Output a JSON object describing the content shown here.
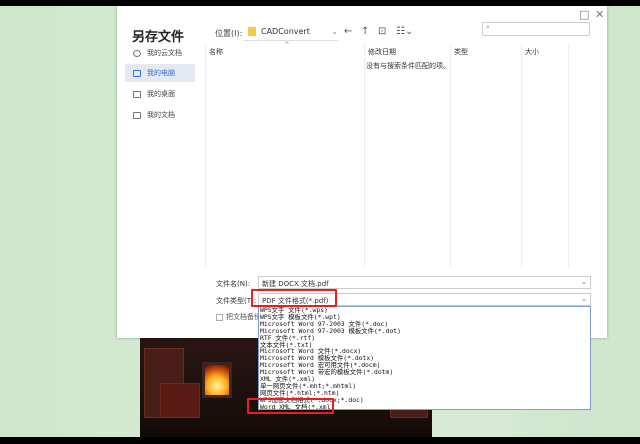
{
  "dialog": {
    "title": "另存文件",
    "maximize_icon": "□",
    "close_icon": "✕",
    "location_label": "位置(I):",
    "location_value": "CADConvert",
    "toolbar": {
      "back": "←",
      "up": "↑",
      "new_folder": "⊡",
      "view": "☷⌄"
    },
    "search_placeholder": "",
    "sidebar": [
      {
        "label": "我的云文档"
      },
      {
        "label": "我的电脑",
        "selected": true
      },
      {
        "label": "我的桌面"
      },
      {
        "label": "我的文档"
      }
    ],
    "columns": [
      "名称",
      "修改日期",
      "类型",
      "大小"
    ],
    "sort_indicator": "^",
    "empty_message": "没有与搜索条件匹配的项。",
    "filename_label": "文件名(N):",
    "filename_value": "新建 DOCX 文档.pdf",
    "filetype_label": "文件类型(T):",
    "filetype_value": "PDF 文件格式(*.pdf)",
    "backup_label": "把文档备份"
  },
  "filetype_options": [
    "WPS文字 文件(*.wps)",
    "WPS文字 模板文件(*.wpt)",
    "Microsoft Word 97-2003 文件(*.doc)",
    "Microsoft Word 97-2003 模板文件(*.dot)",
    "RTF 文件(*.rtf)",
    "文本文件(*.txt)",
    "Microsoft Word 文件(*.docx)",
    "Microsoft Word 模板文件(*.dotx)",
    "Microsoft Word 宏可用文件(*.docm)",
    "Microsoft Word 带宏的模板文件(*.dotm)",
    "XML 文件(*.xml)",
    "单一网页文件(*.mht;*.mhtml)",
    "网页文件(*.html;*.htm)",
    "WPS加密文档格式(*.docx;*.doc)",
    "Word XML 文档(*.xml)",
    "PDF 文件格式(*.pdf)"
  ],
  "selected_option_index": 15,
  "highlight_color": "#e8201a"
}
